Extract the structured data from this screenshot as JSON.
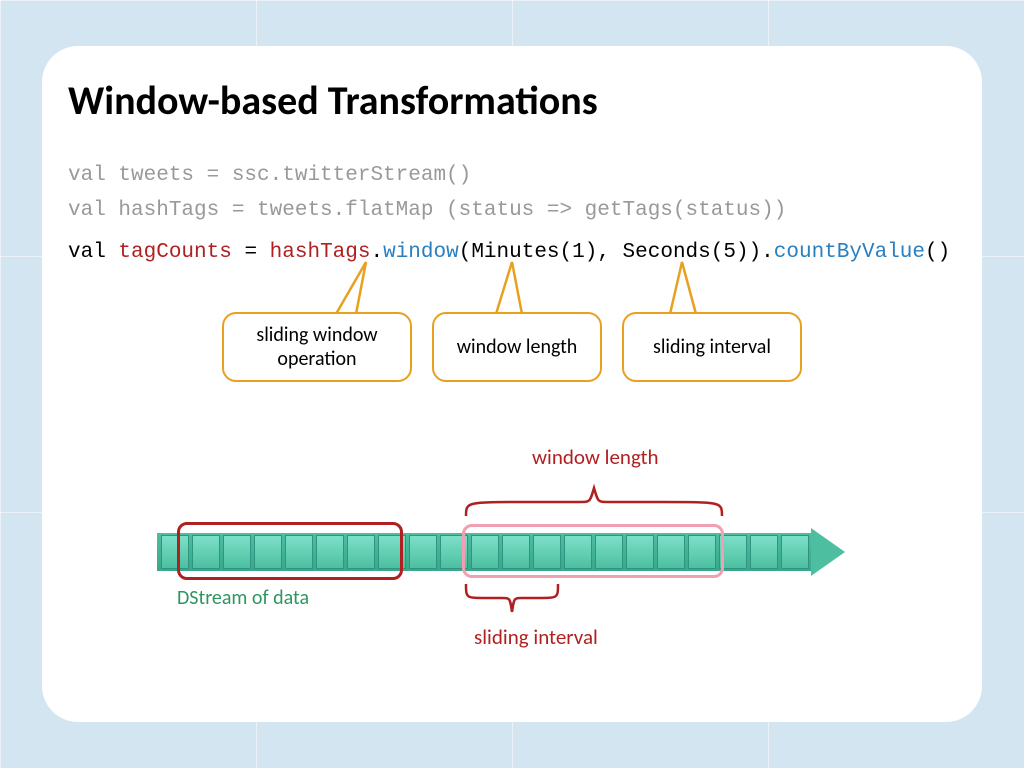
{
  "title": "Window-based Transformations",
  "code": {
    "line1": "val tweets = ssc.twitterStream()",
    "line2": "val hashTags = tweets.flatMap (status => getTags(status))",
    "line3_a": "val ",
    "line3_tagCounts": "tagCounts",
    "line3_b": " = ",
    "line3_hashTags": "hashTags",
    "line3_dot1": ".",
    "line3_window": "window",
    "line3_args": "(Minutes(1), Seconds(5)).",
    "line3_cbv": "countByValue",
    "line3_paren": "()"
  },
  "callouts": {
    "c1": "sliding window\noperation",
    "c2": "window length",
    "c3": "sliding interval"
  },
  "labels": {
    "dstream": "DStream of data",
    "window_length": "window length",
    "sliding_interval": "sliding interval"
  }
}
